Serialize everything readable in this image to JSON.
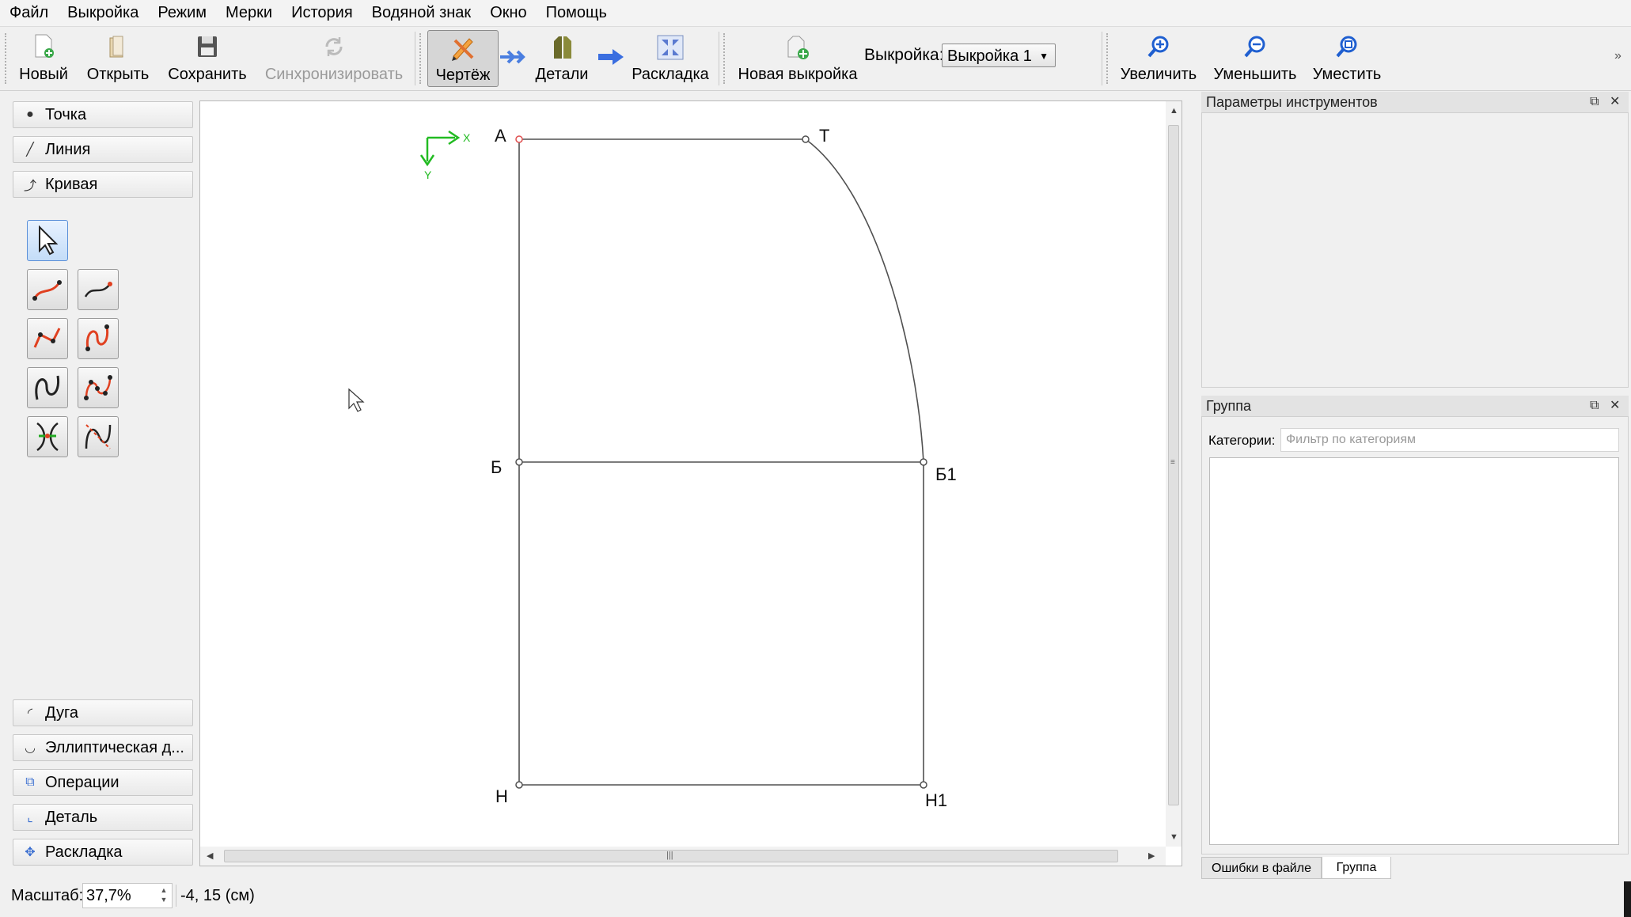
{
  "menu": [
    "Файл",
    "Выкройка",
    "Режим",
    "Мерки",
    "История",
    "Водяной знак",
    "Окно",
    "Помощь"
  ],
  "toolbar": {
    "new_label": "Новый",
    "open_label": "Открыть",
    "save_label": "Сохранить",
    "sync_label": "Синхронизировать",
    "draw_label": "Чертёж",
    "details_label": "Детали",
    "layout_label": "Раскладка",
    "new_pattern_label": "Новая выкройка",
    "pattern_label": "Выкройка:",
    "pattern_value": "Выкройка 1",
    "zoom_in_label": "Увеличить",
    "zoom_out_label": "Уменьшить",
    "fit_label": "Уместить"
  },
  "tool_panel": {
    "categories_top": [
      {
        "label": "Точка",
        "icon": "point-icon"
      },
      {
        "label": "Линия",
        "icon": "line-icon"
      },
      {
        "label": "Кривая",
        "icon": "curve-icon"
      }
    ],
    "tools": [
      "arrow-pointer-icon",
      "curve-tool-icon",
      "curve-interactive-icon",
      "spline-path-icon",
      "spline-path-interactive-icon",
      "cubic-spline-icon",
      "cubic-spline-path-icon",
      "point-on-curve-icon",
      "curve-intersect-icon"
    ],
    "categories_bottom": [
      {
        "label": "Дуга",
        "icon": "arc-icon"
      },
      {
        "label": "Эллиптическая д...",
        "icon": "elliptical-arc-icon"
      },
      {
        "label": "Операции",
        "icon": "operations-icon"
      },
      {
        "label": "Деталь",
        "icon": "detail-icon"
      },
      {
        "label": "Раскладка",
        "icon": "layout-icon"
      }
    ]
  },
  "drawing": {
    "axis_x": "X",
    "axis_y": "Y",
    "points": {
      "A": "А",
      "T": "Т",
      "B": "Б",
      "B1": "Б1",
      "H": "Н",
      "H1": "Н1"
    },
    "line_color": "#505050",
    "base_point_color": "#e05050",
    "axis_color": "#22bb22"
  },
  "docks": {
    "tool_options_title": "Параметры инструментов",
    "group_title": "Группа",
    "categories_label": "Категории:",
    "categories_placeholder": "Фильтр по категориям",
    "tabs": [
      "Ошибки в файле",
      "Группа"
    ]
  },
  "status": {
    "zoom_label": "Масштаб:",
    "zoom_value": "37,7%",
    "coords": "-4, 15 (см)"
  }
}
